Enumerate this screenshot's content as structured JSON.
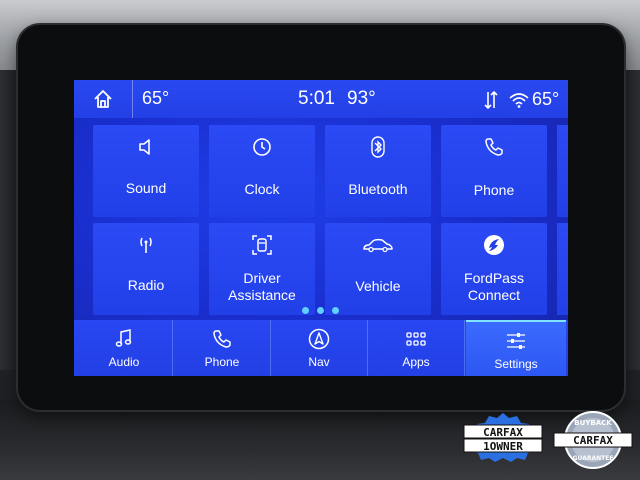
{
  "status": {
    "left_temp": "65°",
    "time": "5:01",
    "center_temp": "93°",
    "right_temp": "65°"
  },
  "tiles": [
    {
      "label": "Sound",
      "icon": "speaker-icon"
    },
    {
      "label": "Clock",
      "icon": "clock-icon"
    },
    {
      "label": "Bluetooth",
      "icon": "bluetooth-icon"
    },
    {
      "label": "Phone",
      "icon": "phone-icon"
    },
    {
      "label": "Radio",
      "icon": "radio-antenna-icon"
    },
    {
      "label_line1": "Driver",
      "label_line2": "Assistance",
      "icon": "driver-assist-icon"
    },
    {
      "label": "Vehicle",
      "icon": "car-icon"
    },
    {
      "label_line1": "FordPass",
      "label_line2": "Connect",
      "icon": "fordpass-icon"
    }
  ],
  "page_indicator": {
    "pages": 3,
    "current": 1
  },
  "nav": [
    {
      "label": "Audio",
      "icon": "music-note-icon"
    },
    {
      "label": "Phone",
      "icon": "phone-icon"
    },
    {
      "label": "Nav",
      "icon": "compass-arrow-icon"
    },
    {
      "label": "Apps",
      "icon": "grid-icon"
    },
    {
      "label": "Settings",
      "icon": "sliders-icon",
      "active": true
    }
  ],
  "badges": {
    "carfax_owner": {
      "line1": "CARFAX",
      "line2": "1OWNER"
    },
    "carfax_buyback": {
      "top": "BUYBACK",
      "brand": "CARFAX",
      "bottom": "GUARANTEE"
    }
  },
  "colors": {
    "screen_blue": "#1f3fe8",
    "tile_blue": "#2b4af5",
    "accent_cyan": "#5fd0ff"
  }
}
